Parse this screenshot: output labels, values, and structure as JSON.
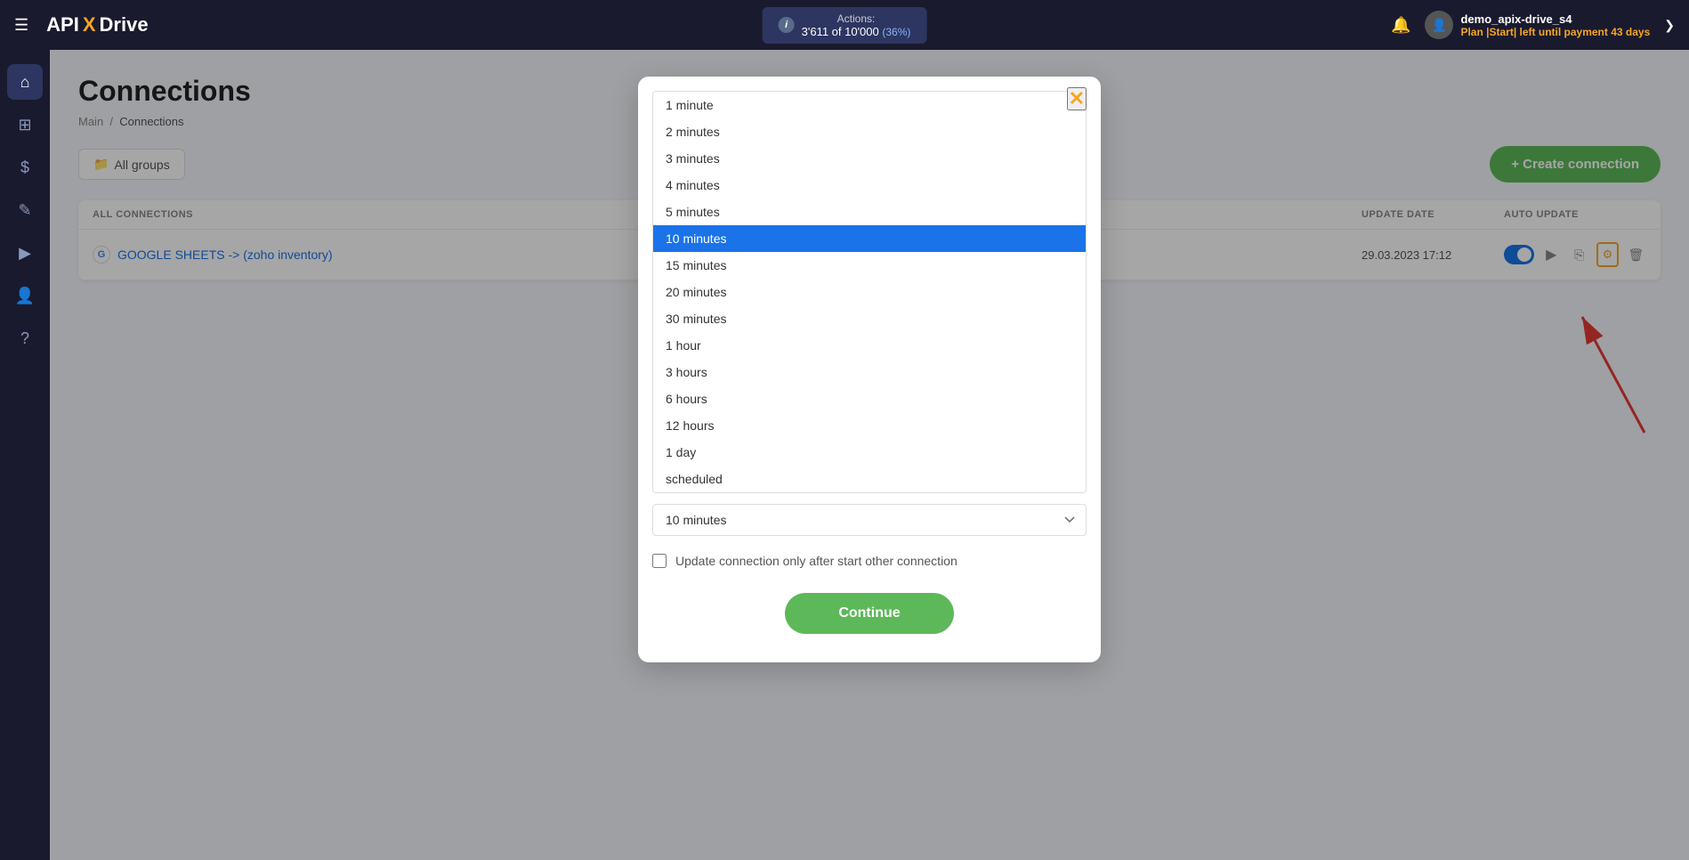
{
  "navbar": {
    "hamburger": "☰",
    "logo": {
      "api": "API",
      "x": "X",
      "drive": "Drive"
    },
    "actions": {
      "label": "Actions:",
      "value": "3'611 of 10'000",
      "percent": "(36%)"
    },
    "user": {
      "name": "demo_apix-drive_s4",
      "plan_text": "Plan |Start| left until payment",
      "plan_days": "43 days"
    },
    "chevron": "❯"
  },
  "sidebar": {
    "icons": [
      {
        "name": "home-icon",
        "glyph": "⌂"
      },
      {
        "name": "dashboard-icon",
        "glyph": "⊞"
      },
      {
        "name": "billing-icon",
        "glyph": "$"
      },
      {
        "name": "briefcase-icon",
        "glyph": "✎"
      },
      {
        "name": "video-icon",
        "glyph": "▶"
      },
      {
        "name": "user-icon",
        "glyph": "👤"
      },
      {
        "name": "help-icon",
        "glyph": "?"
      }
    ]
  },
  "page": {
    "title": "Connections",
    "breadcrumb_main": "Main",
    "breadcrumb_current": "Connections"
  },
  "toolbar": {
    "all_groups_label": "All groups",
    "create_connection_label": "+ Create connection"
  },
  "table": {
    "headers": [
      "ALL CONNECTIONS",
      "",
      "UPDATE DATE",
      "AUTO UPDATE"
    ],
    "row": {
      "name": "GOOGLE SHEETS -> (zoho inventory)",
      "update_date": "29.03.2023 17:12"
    }
  },
  "modal": {
    "close_label": "✕",
    "options": [
      {
        "value": "1 minute",
        "selected": false
      },
      {
        "value": "2 minutes",
        "selected": false
      },
      {
        "value": "3 minutes",
        "selected": false
      },
      {
        "value": "4 minutes",
        "selected": false
      },
      {
        "value": "5 minutes",
        "selected": false
      },
      {
        "value": "10 minutes",
        "selected": true
      },
      {
        "value": "15 minutes",
        "selected": false
      },
      {
        "value": "20 minutes",
        "selected": false
      },
      {
        "value": "30 minutes",
        "selected": false
      },
      {
        "value": "1 hour",
        "selected": false
      },
      {
        "value": "3 hours",
        "selected": false
      },
      {
        "value": "6 hours",
        "selected": false
      },
      {
        "value": "12 hours",
        "selected": false
      },
      {
        "value": "1 day",
        "selected": false
      },
      {
        "value": "scheduled",
        "selected": false
      }
    ],
    "select_value": "10 minutes",
    "checkbox_label": "Update connection only after start other connection",
    "continue_label": "Continue"
  }
}
